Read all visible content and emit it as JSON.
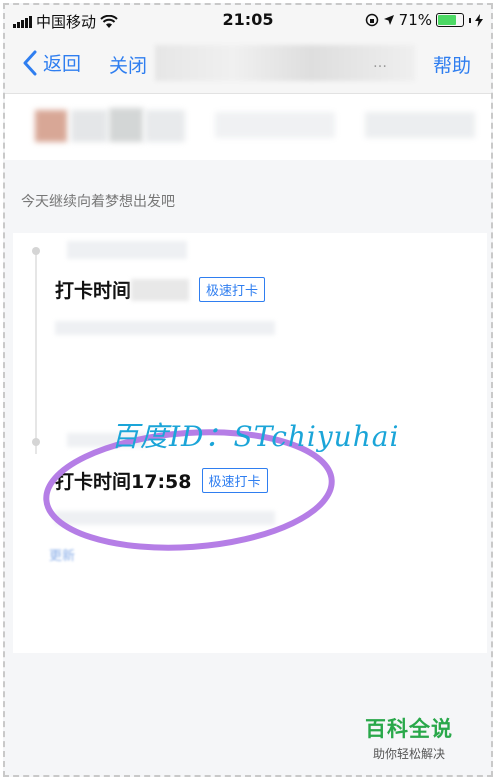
{
  "status_bar": {
    "carrier": "中国移动",
    "time": "21:05",
    "battery": "71%",
    "battery_level": 0.71
  },
  "nav": {
    "back_label": "返回",
    "close_label": "关闭",
    "title_suffix": "…",
    "help_label": "帮助"
  },
  "motto": "今天继续向着梦想出发吧",
  "records": [
    {
      "label": "打卡时间",
      "time": "",
      "tag": "极速打卡"
    },
    {
      "label": "打卡时间",
      "time": "17:58",
      "tag": "极速打卡"
    }
  ],
  "watermark": "百度ID：STchiyuhai",
  "update_text": "更新",
  "brand": {
    "title": "百科全说",
    "subtitle": "助你轻松解决"
  },
  "colors": {
    "accent": "#2f7ef0",
    "watermark": "#1ba5d8",
    "highlight": "#b57ee6",
    "brand": "#29a84a",
    "battery": "#4cd964"
  }
}
